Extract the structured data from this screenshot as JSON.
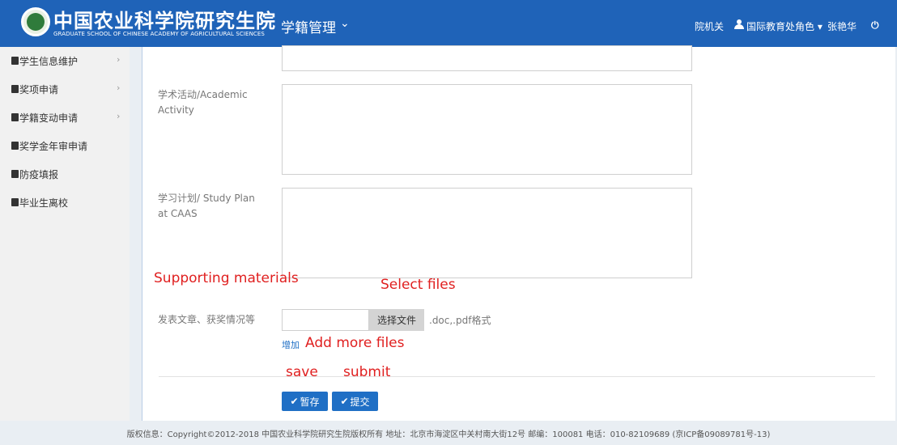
{
  "header": {
    "title": "中国农业科学院研究生院",
    "subtitle": "GRADUATE SCHOOL OF CHINESE ACADEMY OF AGRICULTURAL SCIENCES",
    "module": "学籍管理",
    "module_chevron": "chevron-down-icon",
    "org_link": "院机关",
    "role": "国际教育处角色 ▾",
    "username": "张艳华",
    "power_icon": "power-icon",
    "bg_color": "#1f63b8"
  },
  "sidebar": {
    "items": [
      {
        "label": "学生信息维护",
        "has_arrow": true
      },
      {
        "label": "奖项申请",
        "has_arrow": true
      },
      {
        "label": "学籍变动申请",
        "has_arrow": true
      },
      {
        "label": " 奖学金年审申请",
        "has_arrow": false
      },
      {
        "label": " 防疫填报",
        "has_arrow": false
      },
      {
        "label": " 毕业生离校",
        "has_arrow": false
      }
    ],
    "arrow_glyph": "›"
  },
  "form": {
    "academic_label": "学术活动/Academic Activity",
    "study_plan_label": "学习计划/ Study Plan at CAAS",
    "materials_label": "发表文章、获奖情况等",
    "file_button": "选择文件",
    "file_hint": ".doc,.pdf格式",
    "add_link": "增加"
  },
  "annotations": {
    "supporting": "Supporting materials",
    "select_files": "Select files",
    "add_more": "Add more files",
    "save": "save",
    "submit": "submit",
    "color": "#e02020"
  },
  "buttons": {
    "save_label": "暂存",
    "submit_label": "提交",
    "check_glyph": "✔",
    "color": "#1f6fc5"
  },
  "footer": {
    "text": "版权信息：Copyright©2012-2018 中国农业科学院研究生院版权所有 地址：北京市海淀区中关村南大街12号 邮编：100081 电话：010-82109689 (京ICP备09089781号-13)"
  }
}
